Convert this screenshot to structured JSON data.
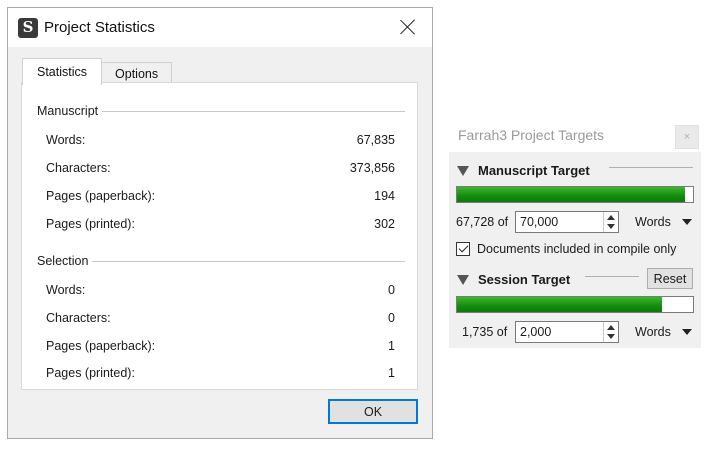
{
  "stats_window": {
    "title": "Project Statistics",
    "app_icon_glyph": "S",
    "tabs": [
      {
        "label": "Statistics",
        "active": true
      },
      {
        "label": "Options",
        "active": false
      }
    ],
    "manuscript": {
      "header": "Manuscript",
      "rows": [
        {
          "label": "Words:",
          "value": "67,835"
        },
        {
          "label": "Characters:",
          "value": "373,856"
        },
        {
          "label": "Pages (paperback):",
          "value": "194"
        },
        {
          "label": "Pages (printed):",
          "value": "302"
        }
      ]
    },
    "selection": {
      "header": "Selection",
      "rows": [
        {
          "label": "Words:",
          "value": "0"
        },
        {
          "label": "Characters:",
          "value": "0"
        },
        {
          "label": "Pages (paperback):",
          "value": "1"
        },
        {
          "label": "Pages (printed):",
          "value": "1"
        }
      ]
    },
    "ok_label": "OK"
  },
  "targets_panel": {
    "title": "Farrah3 Project Targets",
    "close_glyph": "×",
    "manuscript_target": {
      "header": "Manuscript Target",
      "progress_fraction": 0.968,
      "current": "67,728 of",
      "target": "70,000",
      "unit": "Words",
      "compile_only_label": "Documents included in compile only",
      "compile_only_checked": true
    },
    "session_target": {
      "header": "Session Target",
      "reset_label": "Reset",
      "progress_fraction": 0.868,
      "current": "1,735 of",
      "target": "2,000",
      "unit": "Words"
    }
  }
}
